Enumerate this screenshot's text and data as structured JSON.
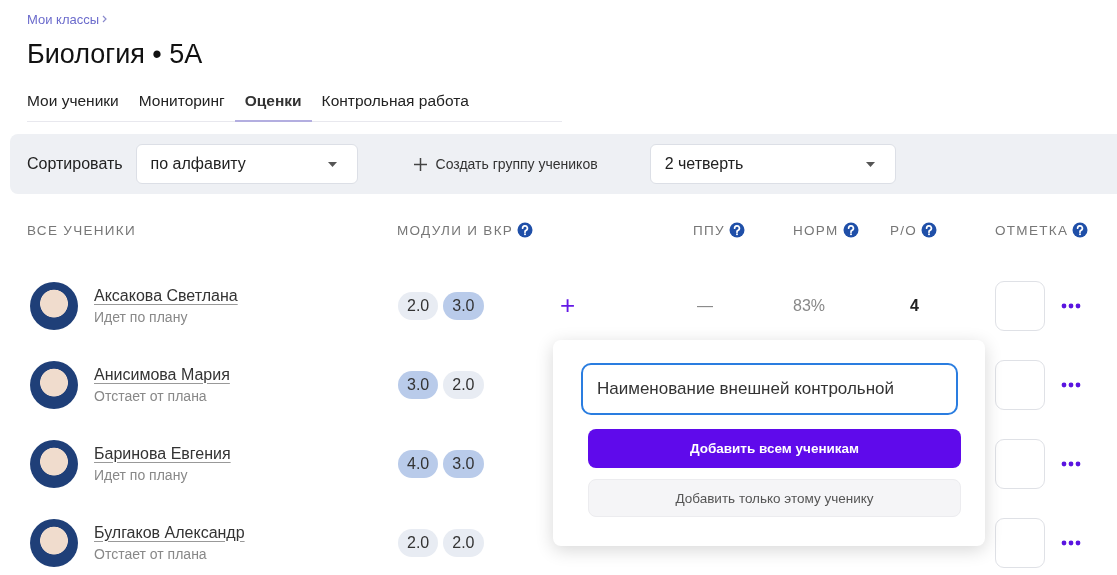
{
  "breadcrumb": {
    "label": "Мои классы"
  },
  "title": "Биология • 5А",
  "tabs": [
    {
      "label": "Мои ученики",
      "selected": false
    },
    {
      "label": "Мониторинг",
      "selected": false
    },
    {
      "label": "Оценки",
      "selected": true
    },
    {
      "label": "Контрольная работа",
      "selected": false
    }
  ],
  "toolbar": {
    "sort_label": "Сортировать",
    "sort_value": "по алфавиту",
    "create_group": "Создать группу учеников",
    "period_value": "2 четверть"
  },
  "table": {
    "columns": [
      {
        "label": "ВСЕ УЧЕНИКИ",
        "help": false
      },
      {
        "label": "МОДУЛИ И ВКР",
        "help": true
      },
      {
        "help": false
      },
      {
        "label": "ППУ",
        "help": true
      },
      {
        "label": "НОРМ",
        "help": true
      },
      {
        "label": "Р/О",
        "help": true
      },
      {
        "label": "ОТМЕТКА",
        "help": true
      }
    ],
    "rows": [
      {
        "name": "Аксакова Светлана",
        "status": "Идет по плану",
        "grades": [
          {
            "value": "2.0",
            "highlighted": false
          },
          {
            "value": "3.0",
            "highlighted": true
          }
        ],
        "add": "+",
        "ppu": "—",
        "norm": "83%",
        "ro": "4"
      },
      {
        "name": "Анисимова Мария",
        "status": "Отстает от плана",
        "grades": [
          {
            "value": "3.0",
            "highlighted": true
          },
          {
            "value": "2.0",
            "highlighted": false
          }
        ]
      },
      {
        "name": "Баринова Евгения",
        "status": "Идет по плану",
        "grades": [
          {
            "value": "4.0",
            "highlighted": true
          },
          {
            "value": "3.0",
            "highlighted": true
          }
        ]
      },
      {
        "name": "Булгаков Александр",
        "status": "Отстает от плана",
        "grades": [
          {
            "value": "2.0",
            "highlighted": false
          },
          {
            "value": "2.0",
            "highlighted": false
          }
        ]
      }
    ]
  },
  "popover": {
    "value": "Наименование внешней контрольной",
    "buttons": [
      {
        "label": "Добавить всем ученикам",
        "kind": "primary"
      },
      {
        "label": "Добавить только этому ученику",
        "kind": "secondary"
      }
    ]
  }
}
